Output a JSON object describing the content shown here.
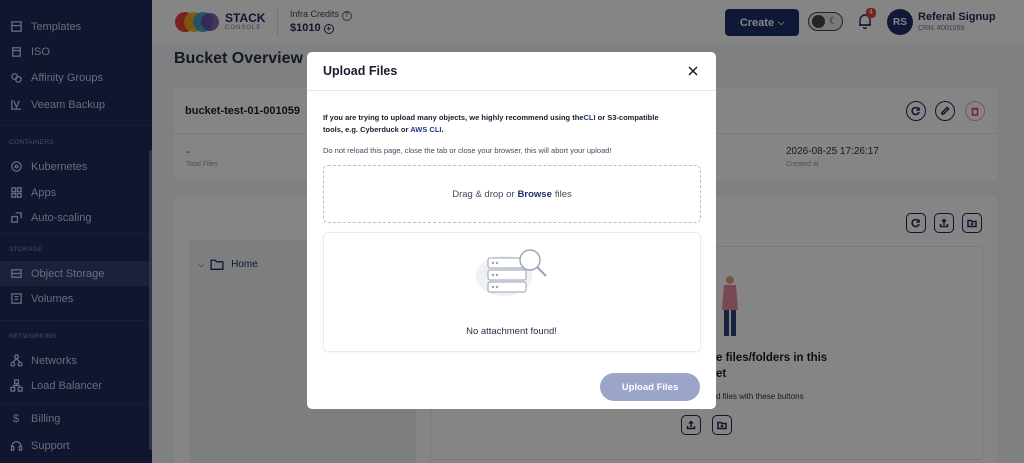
{
  "sidebar": {
    "items": [
      {
        "label": "Templates",
        "icon": "template-icon"
      },
      {
        "label": "ISO",
        "icon": "iso-icon"
      },
      {
        "label": "Affinity Groups",
        "icon": "affinity-icon"
      },
      {
        "label": "Veeam Backup",
        "icon": "backup-icon"
      },
      {
        "label": "Kubernetes",
        "icon": "kubernetes-icon"
      },
      {
        "label": "Apps",
        "icon": "apps-icon"
      },
      {
        "label": "Auto-scaling",
        "icon": "autoscale-icon"
      },
      {
        "label": "Object Storage",
        "icon": "storage-icon"
      },
      {
        "label": "Volumes",
        "icon": "volume-icon"
      },
      {
        "label": "Networks",
        "icon": "network-icon"
      },
      {
        "label": "Load Balancer",
        "icon": "loadbalancer-icon"
      },
      {
        "label": "Billing",
        "icon": "dollar-icon"
      },
      {
        "label": "Support",
        "icon": "headset-icon"
      }
    ],
    "sections": {
      "containers": "CONTAINERS",
      "storage": "STORAGE",
      "networking": "NETWORKING"
    }
  },
  "header": {
    "logo_text": "STACK",
    "logo_sub": "CONSOLE",
    "credits_label": "Infra Credits",
    "credits_value": "$1010",
    "create_label": "Create",
    "notification_count": "4",
    "avatar_initials": "RS",
    "user_name": "Referal Signup",
    "user_crn": "CRN: #001059"
  },
  "page": {
    "title": "Bucket Overview",
    "bucket_name": "bucket-test-01-001059",
    "total_files_value": "-",
    "total_files_label": "Total Files",
    "created_value": "2026-08-25 17:26:17",
    "created_label": "Created at",
    "tree_home": "Home",
    "empty_title": "e files/folders in this\net",
    "empty_sub": "d files with these buttons"
  },
  "modal": {
    "title": "Upload Files",
    "info_part1": "If you are trying to upload many objects, we highly recommend using the",
    "info_cli": "CLI",
    "info_part2": " or S3-compatible tools, e.g. Cyberduck or ",
    "info_aws": "AWS CLI",
    "info_end": ".",
    "warning": "Do not reload this page, close the tab or close your browser, this will abort your upload!",
    "drop_prefix": "Drag & drop or",
    "drop_browse": "Browse",
    "drop_suffix": "files",
    "empty_attachment": "No attachment found!",
    "upload_button": "Upload Files"
  },
  "colors": {
    "sidebar_bg": "#1f2a5c",
    "primary": "#1f2f6a",
    "upload_btn_disabled": "#9aa5c8",
    "danger": "#d9534f"
  }
}
